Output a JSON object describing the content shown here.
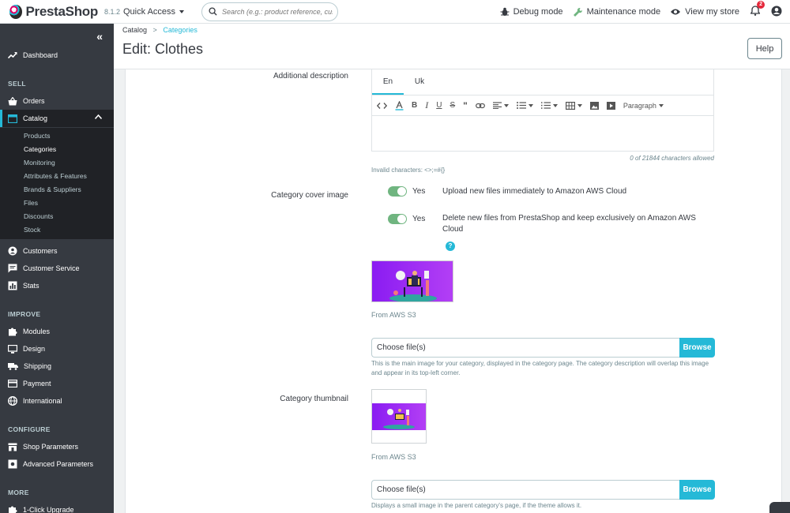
{
  "topbar": {
    "logo_text": "PrestaShop",
    "version": "8.1.2",
    "quick_access": "Quick Access",
    "search_placeholder": "Search (e.g.: product reference, custon",
    "debug_mode": "Debug mode",
    "maintenance_mode": "Maintenance mode",
    "view_store": "View my store",
    "notification_count": "2"
  },
  "sidebar": {
    "collapse": "«",
    "dashboard": "Dashboard",
    "sections": {
      "sell": "SELL",
      "improve": "IMPROVE",
      "configure": "CONFIGURE",
      "more": "MORE"
    },
    "items": {
      "orders": "Orders",
      "catalog": "Catalog",
      "customers": "Customers",
      "customer_service": "Customer Service",
      "stats": "Stats",
      "modules": "Modules",
      "design": "Design",
      "shipping": "Shipping",
      "payment": "Payment",
      "international": "International",
      "shop_parameters": "Shop Parameters",
      "advanced_parameters": "Advanced Parameters",
      "one_click_upgrade": "1-Click Upgrade"
    },
    "catalog_sub": [
      "Products",
      "Categories",
      "Monitoring",
      "Attributes & Features",
      "Brands & Suppliers",
      "Files",
      "Discounts",
      "Stock"
    ]
  },
  "header": {
    "breadcrumb_root": "Catalog",
    "breadcrumb_sep": ">",
    "breadcrumb_current": "Categories",
    "title": "Edit: Clothes",
    "help": "Help"
  },
  "form": {
    "additional_description": {
      "label": "Additional description",
      "tabs": [
        "En",
        "Uk"
      ],
      "paragraph": "Paragraph",
      "char_count": "0 of 21844 characters allowed",
      "invalid_chars": "Invalid characters: <>;=#{}"
    },
    "cover_image": {
      "label": "Category cover image",
      "switch1_label": "Yes",
      "switch1_desc": "Upload new files immediately to Amazon AWS Cloud",
      "switch2_label": "Yes",
      "switch2_desc": "Delete new files from PrestaShop and keep exclusively on Amazon AWS Cloud",
      "help": "?",
      "source": "From AWS S3",
      "file_placeholder": "Choose file(s)",
      "browse": "Browse",
      "hint": "This is the main image for your category, displayed in the category page. The category description will overlap this image and appear in its top-left corner."
    },
    "thumbnail": {
      "label": "Category thumbnail",
      "source": "From AWS S3",
      "file_placeholder": "Choose file(s)",
      "browse": "Browse",
      "hint": "Displays a small image in the parent category's page, if the theme allows it."
    }
  },
  "colors": {
    "accent": "#25b9d7",
    "sidebar": "#363a41",
    "switch_on": "#70b580",
    "image_bg": "#8a1cf2"
  }
}
